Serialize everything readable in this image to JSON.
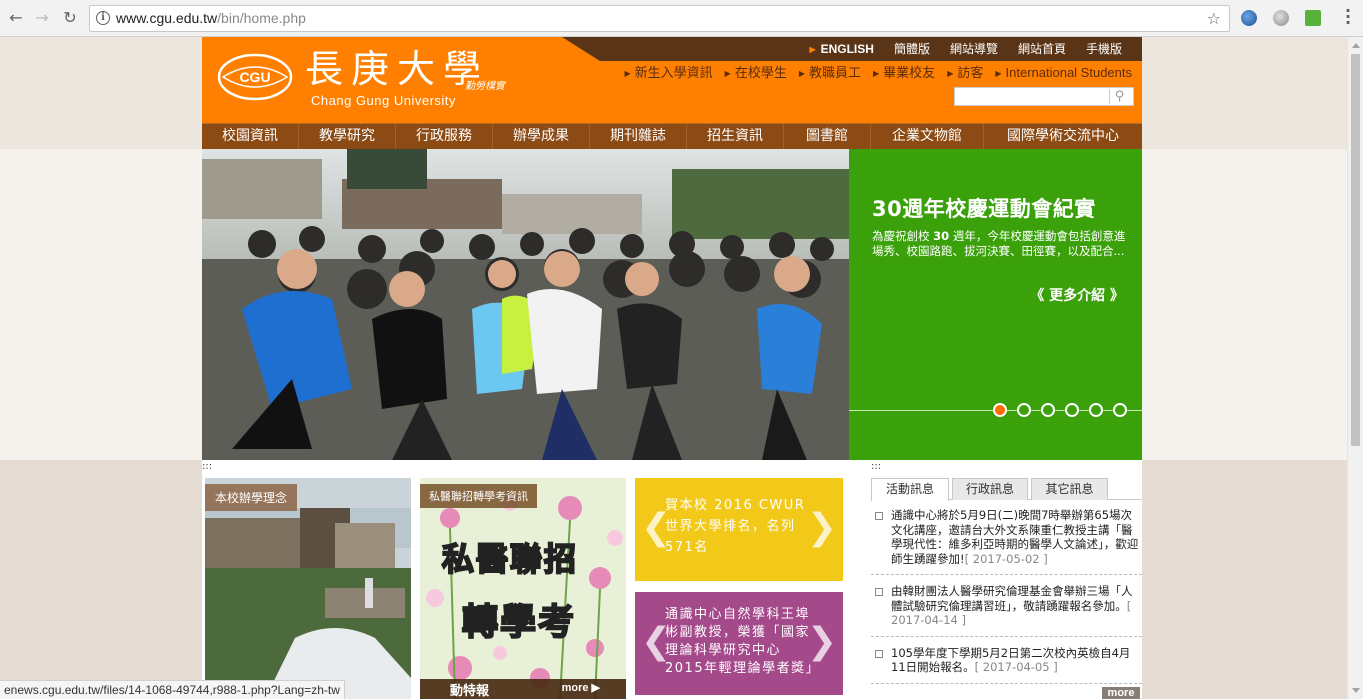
{
  "browser": {
    "url_host": "www.cgu.edu.tw",
    "url_path": "/bin/home.php",
    "status_url": "enews.cgu.edu.tw/files/14-1068-49744,r988-1.php?Lang=zh-tw"
  },
  "header": {
    "logo_cn": "長庚大學",
    "logo_motto": "勤勞樸實",
    "logo_en": "Chang Gung University",
    "top_links": [
      "ENGLISH",
      "簡體版",
      "網站導覽",
      "網站首頁",
      "手機版"
    ],
    "sub_links": [
      "新生入學資訊",
      "在校學生",
      "教職員工",
      "畢業校友",
      "訪客",
      "International Students"
    ],
    "search_placeholder": ""
  },
  "main_nav": [
    "校園資訊",
    "教學研究",
    "行政服務",
    "辦學成果",
    "期刊雜誌",
    "招生資訊",
    "圖書館",
    "企業文物館",
    "國際學術交流中心"
  ],
  "hero": {
    "title": "30週年校慶運動會紀實",
    "desc_pre": "為慶祝創校 ",
    "desc_bold": "30",
    "desc_post": " 週年，今年校慶運動會包括創意進場秀、校園路跑、拔河決賽、田徑賽，以及配合...",
    "more": "《 更多介紹 》",
    "slide_count": 6,
    "active_slide": 1
  },
  "content": {
    "separator": ":::",
    "card1_label": "本校辦學理念",
    "card2_label": "私醫聯招轉學考資訊",
    "card2_big1": "私醫聯招",
    "card2_big2": "轉學考",
    "card2_more_left": "動特報",
    "card2_more_right": "more ▶",
    "card3_text": "賀本校 2016 CWUR 世界大學排名，名列 571名",
    "card4_text": "通識中心自然學科王埠彬副教授，榮獲「國家理論科學研究中心2015年輕理論學者獎」"
  },
  "news": {
    "tabs": [
      "活動訊息",
      "行政訊息",
      "其它訊息"
    ],
    "active_tab": 0,
    "items": [
      {
        "text": "通識中心將於5月9日(二)晚間7時舉辦第65場次文化講座，邀請台大外文系陳重仁教授主講「醫學現代性：維多利亞時期的醫學人文論述」，歡迎師生踴躍參加!",
        "date": "[ 2017-05-02 ]"
      },
      {
        "text": "由韓財團法人醫學研究倫理基金會舉辦三場「人體試驗研究倫理講習班」，敬請踴躍報名參加。",
        "date": "[ 2017-04-14 ]"
      },
      {
        "text": "105學年度下學期5月2日第二次校內英檢自4月11日開始報名。",
        "date": "[ 2017-04-05 ]"
      }
    ],
    "more": "more"
  },
  "colors": {
    "header_orange": "#ff8000",
    "nav_brown": "#8c4a14",
    "hero_green": "#3aa10a",
    "promo_yellow": "#f2c918",
    "promo_purple": "#a4498a"
  }
}
